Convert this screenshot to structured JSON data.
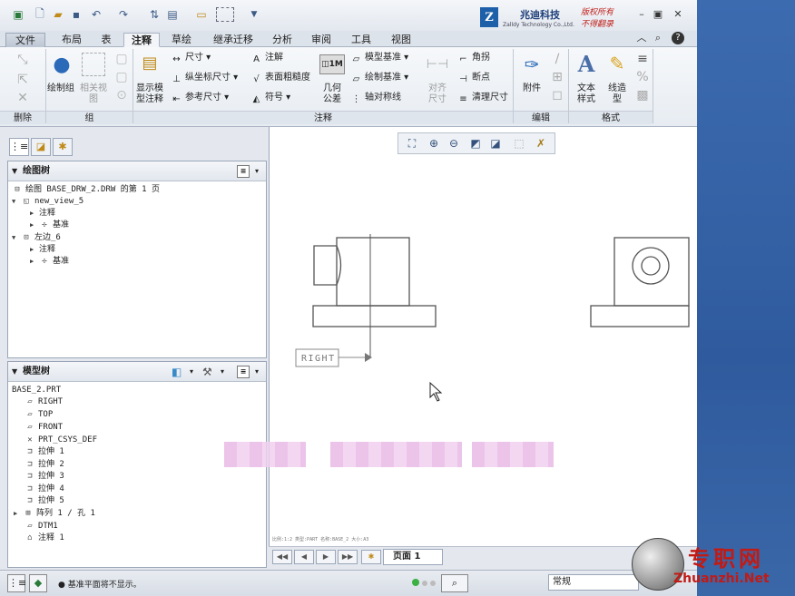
{
  "brand": {
    "logo_letter": "Z",
    "name": "兆迪科技",
    "sub": "Zalldy Technology Co.,Ltd.",
    "slogan_1": "版权所有",
    "slogan_2": "不得翻录"
  },
  "tabs": [
    "文件",
    "布局",
    "表",
    "注释",
    "草绘",
    "继承迁移",
    "分析",
    "审阅",
    "工具",
    "视图"
  ],
  "active_tab": "注释",
  "ribbon": {
    "groups": {
      "delete": "删除",
      "group": "组",
      "annotate": "注释",
      "edit": "编辑",
      "format": "格式"
    },
    "draw_group": "绘制组",
    "related_view": "相关视图",
    "show_model_annotations": [
      "显示模",
      "型注释"
    ],
    "dimension": "尺寸",
    "ordinate_dimension": "纵坐标尺寸",
    "reference_dimension": "参考尺寸",
    "note": "注解",
    "surface_finish": "表面粗糙度",
    "symbol": "符号",
    "geometric_tolerance": [
      "几何",
      "公差"
    ],
    "model_datum": "模型基准",
    "sketch_datum": "绘制基准",
    "axis_symmetry": "轴对称线",
    "align_dimension": [
      "对齐",
      "尺寸"
    ],
    "corner": "角拐",
    "breakpoint": "断点",
    "cleanup_dimension": "清理尺寸",
    "attachment": "附件",
    "text_style": [
      "文本",
      "样式"
    ],
    "line_style": [
      "线造",
      "型"
    ]
  },
  "drawing_tree": {
    "title": "绘图树",
    "items": [
      "绘图 BASE_DRW_2.DRW 的第 1 页",
      "new_view_5",
      "注释",
      "基准",
      "左边_6",
      "注释",
      "基准"
    ]
  },
  "model_tree": {
    "title": "模型树",
    "items": [
      "BASE_2.PRT",
      "RIGHT",
      "TOP",
      "FRONT",
      "PRT_CSYS_DEF",
      "拉伸 1",
      "拉伸 2",
      "拉伸 3",
      "拉伸 4",
      "拉伸 5",
      "阵列 1 / 孔 1",
      "DTM1",
      "注释 1"
    ]
  },
  "canvas": {
    "datum_label": "RIGHT",
    "info_line": "比例:1:2    类型:PART    名称:BASE_2    大小:A3"
  },
  "page_nav": {
    "page_label": "页面 1"
  },
  "status": {
    "message": "基准平面将不显示。",
    "filter_value": "常规"
  },
  "watermark": {
    "text": "专职网",
    "url": "Zhuanzhi.Net"
  }
}
